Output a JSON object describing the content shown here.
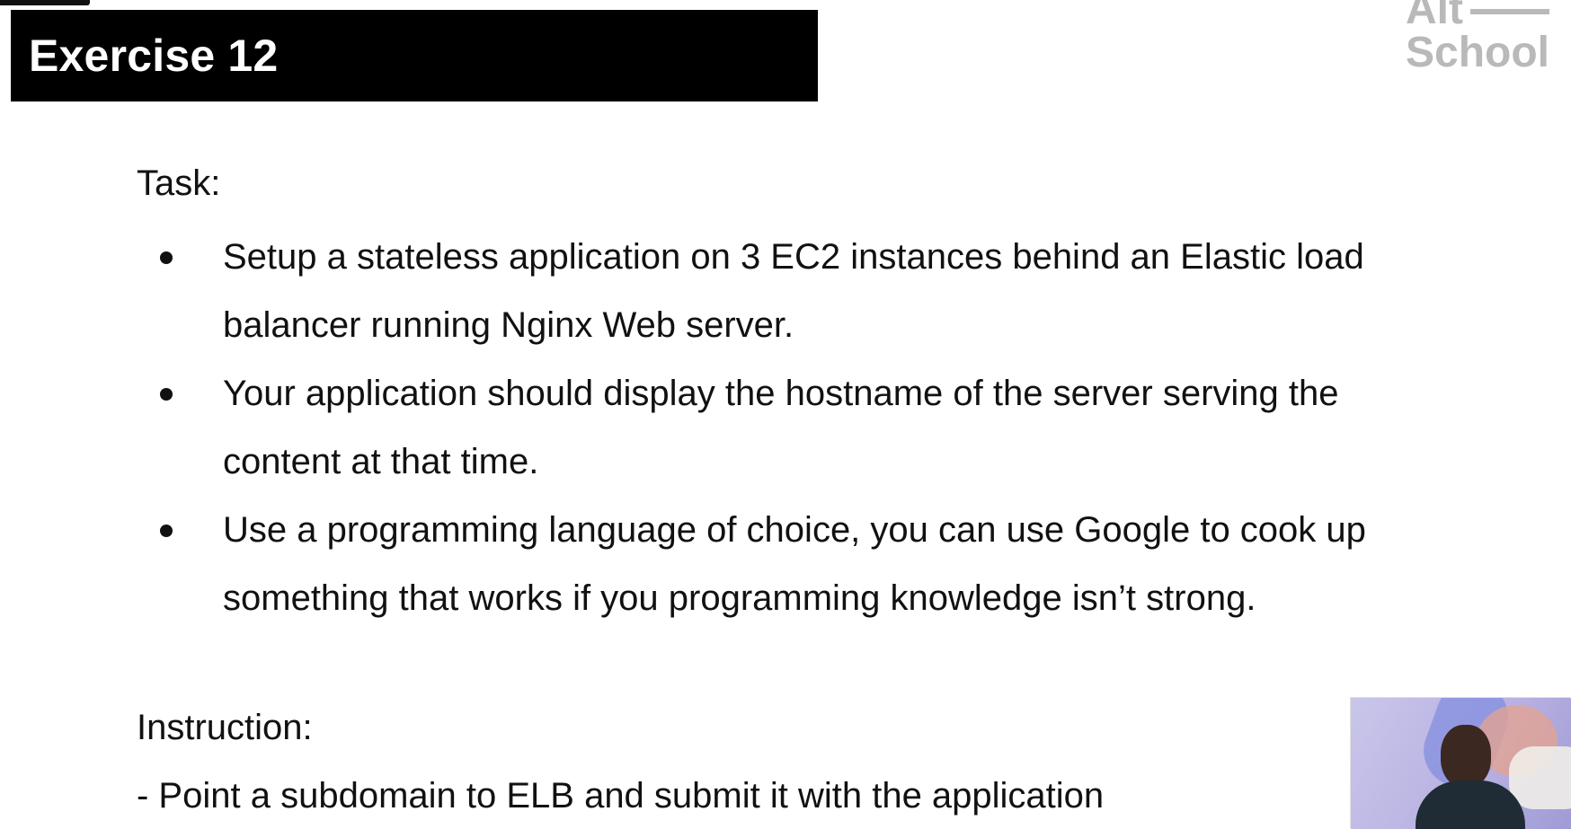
{
  "slide": {
    "title": "Exercise 12",
    "task_label": "Task:",
    "bullets": [
      "Setup a stateless application on 3 EC2 instances behind an Elastic load balancer running Nginx Web server.",
      "Your application should display the hostname of the server serving the content at that time.",
      "Use a programming language of choice, you can use Google to cook up something that works if you programming knowledge isn’t strong."
    ],
    "instruction_label": "Instruction:",
    "instruction_text": "- Point a subdomain to ELB and submit it with the application"
  },
  "brand": {
    "logo_line_1": "Alt",
    "logo_line_2": "School"
  },
  "colors": {
    "title_bar": "#000000",
    "title_text": "#ffffff",
    "body_text": "#111111",
    "logo": "#b9b9b9"
  },
  "icons": {
    "bullet": "filled-circle",
    "webcam": "presenter-video-thumbnail"
  }
}
